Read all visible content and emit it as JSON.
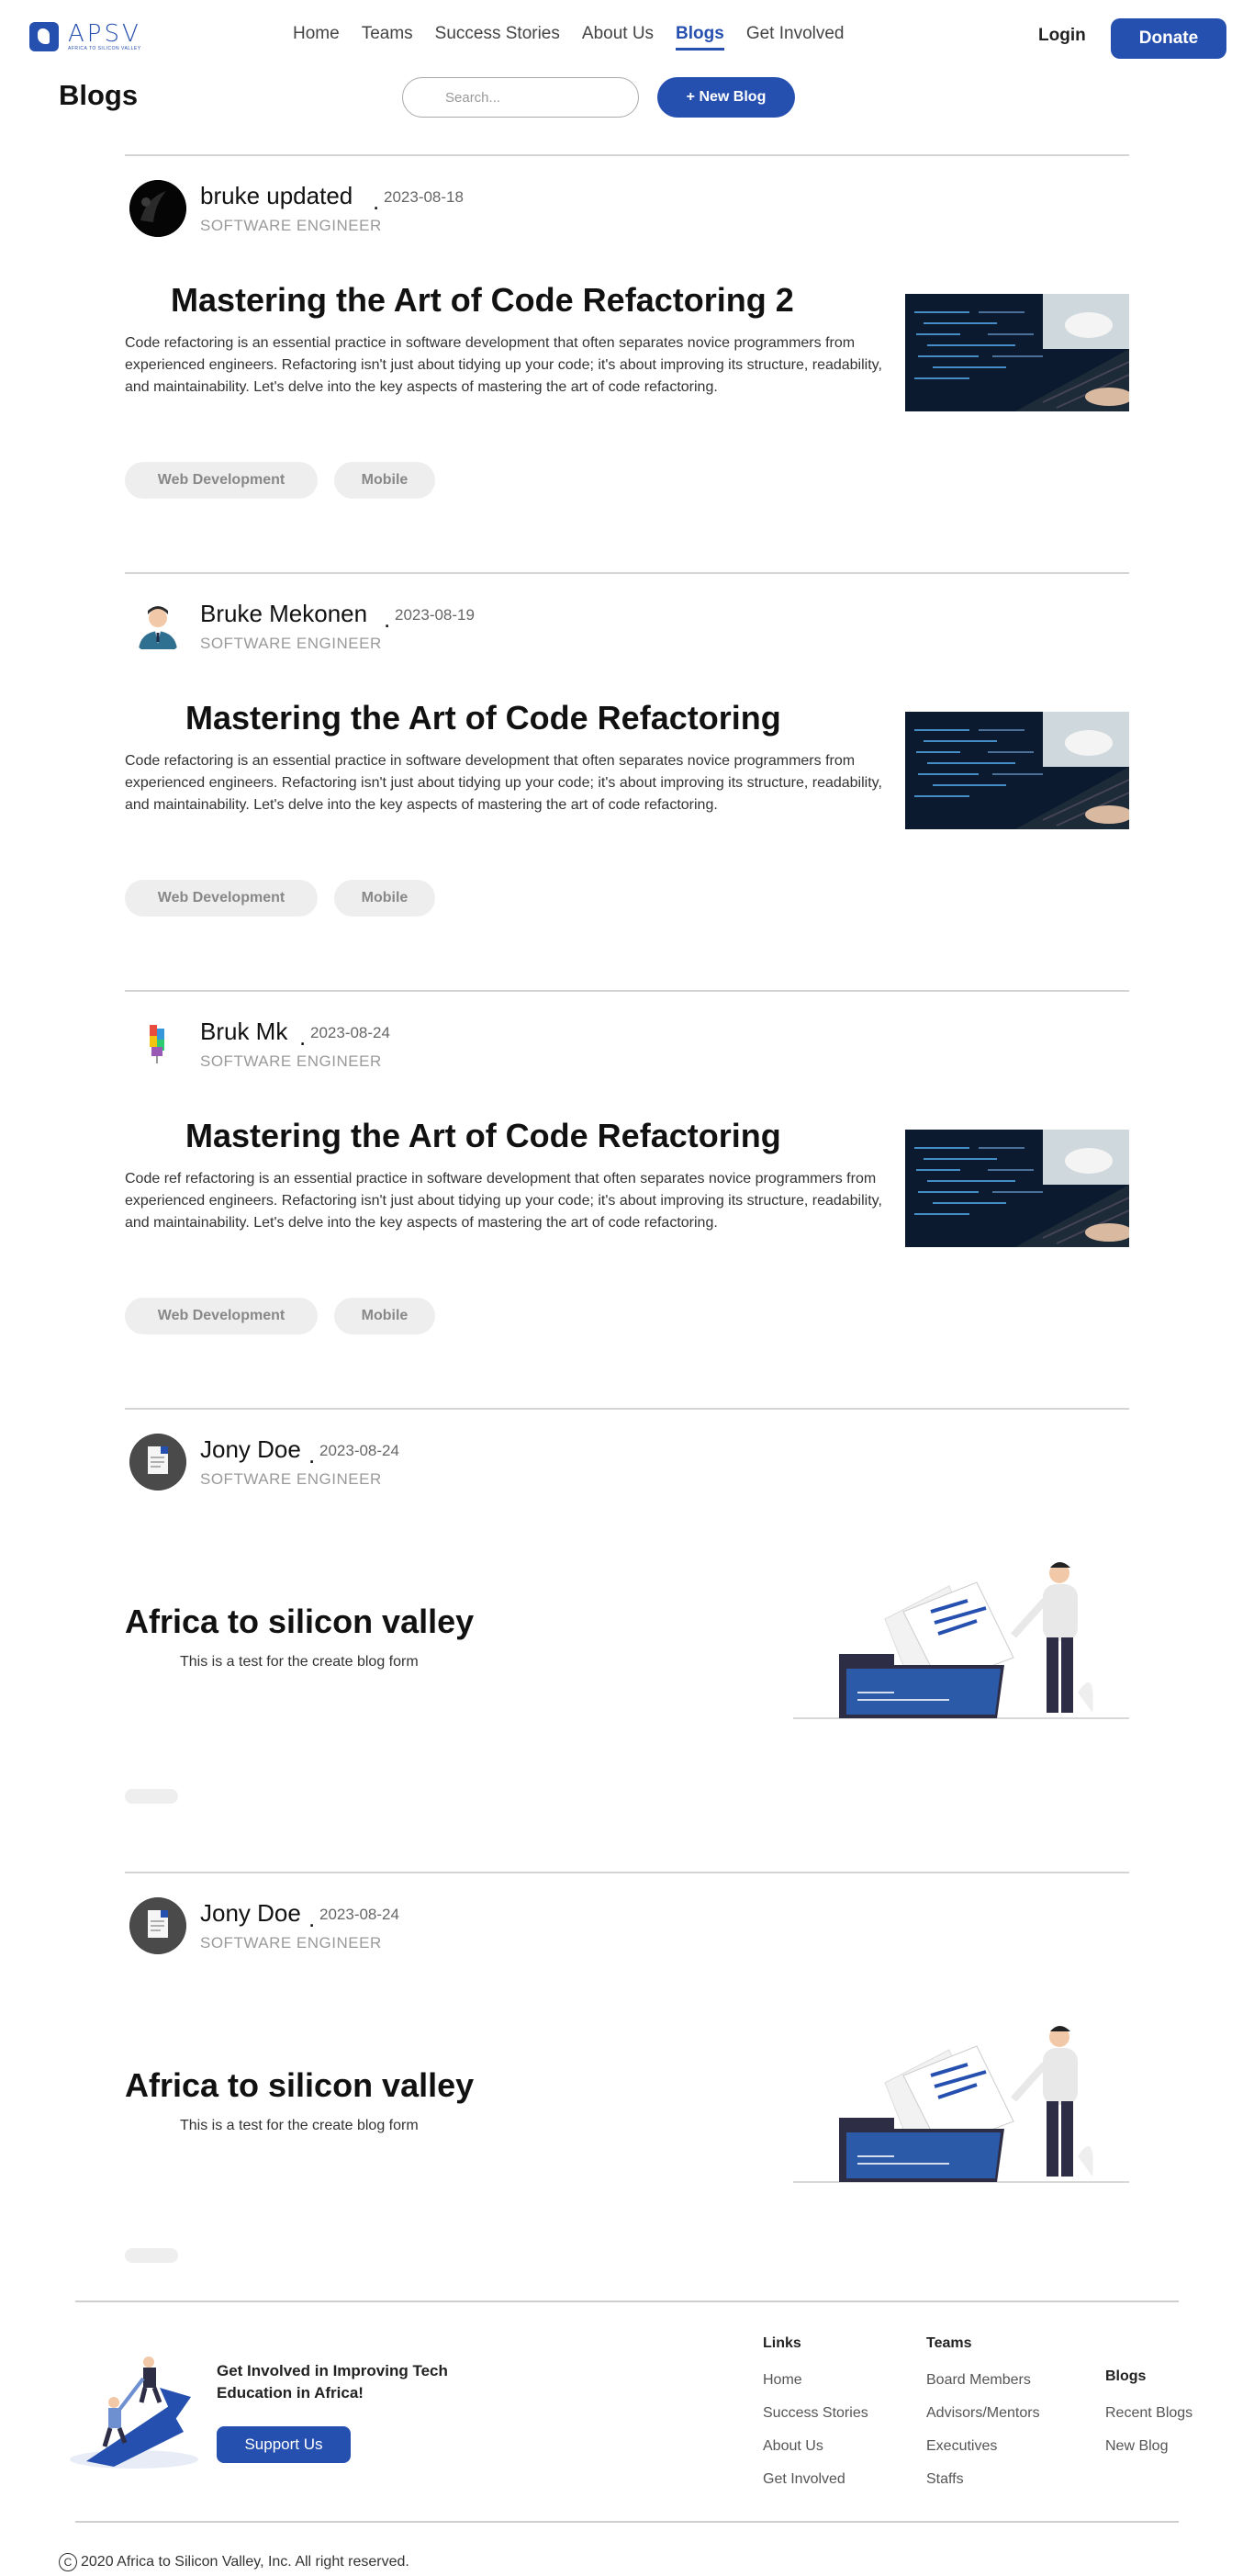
{
  "brand": {
    "logo_text": "APSV",
    "logo_subtitle": "AFRICA TO SILICON VALLEY",
    "primary_color": "#2650b0"
  },
  "nav": {
    "links": [
      "Home",
      "Teams",
      "Success Stories",
      "About Us",
      "Blogs",
      "Get Involved"
    ],
    "active": "Blogs",
    "login": "Login",
    "donate": "Donate"
  },
  "header": {
    "title": "Blogs",
    "search_placeholder": "Search...",
    "new_blog": "+ New Blog"
  },
  "posts": [
    {
      "author": "bruke updated",
      "date": "2023-08-18",
      "role": "SOFTWARE ENGINEER",
      "avatar": "dark-avatar",
      "title": "Mastering the Art of Code Refactoring 2",
      "description": "Code refactoring is an essential practice in software development that often separates novice programmers from experienced engineers. Refactoring isn't just about tidying up your code; it's about improving its structure, readability, and maintainability. Let's delve into the key aspects of mastering the art of code refactoring.",
      "tags": [
        "Web Development",
        "Mobile"
      ],
      "image": "laptop-code-photo"
    },
    {
      "author": "Bruke Mekonen",
      "date": "2023-08-19",
      "role": "SOFTWARE ENGINEER",
      "avatar": "person-avatar",
      "title": "Mastering the Art of Code Refactoring",
      "description": "Code refactoring is an essential practice in software development that often separates novice programmers from experienced engineers. Refactoring isn't just about tidying up your code; it's about improving its structure, readability, and maintainability. Let's delve into the key aspects of mastering the art of code refactoring.",
      "tags": [
        "Web Development",
        "Mobile"
      ],
      "image": "laptop-code-photo"
    },
    {
      "author": "Bruk Mk",
      "date": "2023-08-24",
      "role": "SOFTWARE ENGINEER",
      "avatar": "blocks-avatar",
      "title": "Mastering the Art of Code Refactoring",
      "description": "Code ref refactoring is an essential practice in software development that often separates novice programmers from experienced engineers. Refactoring isn't just about tidying up your code; it's about improving its structure, readability, and maintainability. Let's delve into the key aspects of mastering the art of code refactoring.",
      "tags": [
        "Web Development",
        "Mobile"
      ],
      "image": "laptop-code-photo"
    },
    {
      "author": "Jony Doe",
      "date": "2023-08-24",
      "role": "SOFTWARE ENGINEER",
      "avatar": "document-avatar",
      "title": "Africa to silicon valley",
      "description": "This is a test for the create blog form",
      "tags": [],
      "image": "filing-illustration"
    },
    {
      "author": "Jony Doe",
      "date": "2023-08-24",
      "role": "SOFTWARE ENGINEER",
      "avatar": "document-avatar",
      "title": "Africa to silicon valley",
      "description": "This is a test for the create blog form",
      "tags": [],
      "image": "filing-illustration"
    }
  ],
  "footer": {
    "cta": "Get Involved in Improving Tech Education in Africa!",
    "support": "Support Us",
    "columns": [
      {
        "heading": "Links",
        "items": [
          "Home",
          "Success Stories",
          "About Us",
          "Get Involved"
        ]
      },
      {
        "heading": "Teams",
        "items": [
          "Board Members",
          "Advisors/Mentors",
          "Executives",
          "Staffs"
        ]
      },
      {
        "heading": "Blogs",
        "items": [
          "Recent Blogs",
          "New Blog"
        ]
      }
    ],
    "copyright_symbol": "C",
    "copyright": "2020 Africa to Silicon Valley, Inc. All right reserved."
  }
}
